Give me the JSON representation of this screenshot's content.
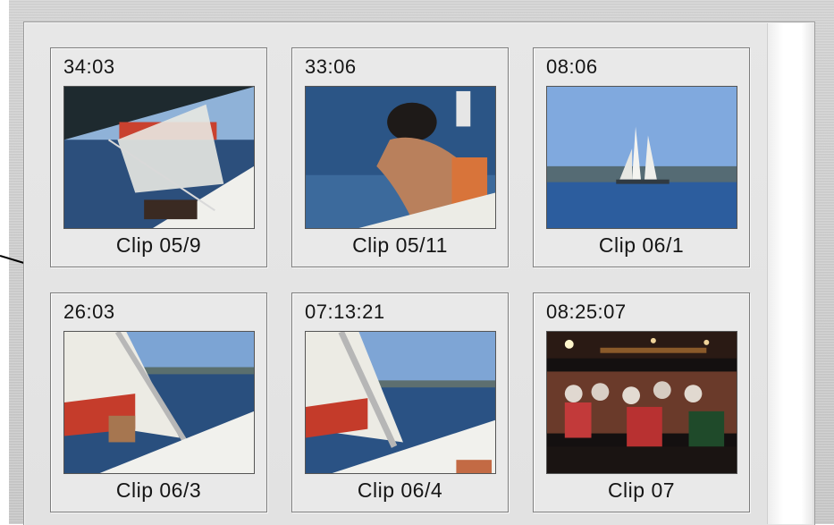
{
  "clips": [
    {
      "duration": "34:03",
      "name": "Clip 05/9",
      "scene": "sailboat-deck-icon"
    },
    {
      "duration": "33:06",
      "name": "Clip 05/11",
      "scene": "sailor-bow-icon"
    },
    {
      "duration": "08:06",
      "name": "Clip 06/1",
      "scene": "sailboat-distance-icon"
    },
    {
      "duration": "26:03",
      "name": "Clip 06/3",
      "scene": "sail-mast-icon"
    },
    {
      "duration": "07:13:21",
      "name": "Clip 06/4",
      "scene": "sail-mast-icon"
    },
    {
      "duration": "08:25:07",
      "name": "Clip 07",
      "scene": "night-crowd-icon"
    }
  ],
  "colors": {
    "sea": "#23487a",
    "sky": "#7fa6d8",
    "sail": "#f2f2ee",
    "red": "#c43a2a"
  }
}
